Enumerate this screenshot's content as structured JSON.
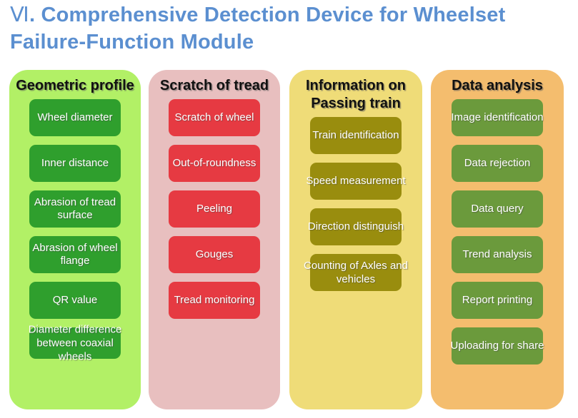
{
  "title": {
    "numeral": "Ⅵ",
    "text": ". Comprehensive Detection Device for Wheelset Failure-Function Module",
    "color": "#5b8fd0"
  },
  "columns": [
    {
      "id": "geometric-profile",
      "header": "Geometric profile",
      "panel_color": "#b2f066",
      "box_color": "#2f9f2d",
      "items": [
        "Wheel diameter",
        "Inner distance",
        "Abrasion of tread surface",
        "Abrasion of wheel flange",
        "QR value",
        "Diameter difference between coaxial wheels"
      ]
    },
    {
      "id": "scratch-of-tread",
      "header": "Scratch of tread",
      "panel_color": "#e8bfbf",
      "box_color": "#e63a42",
      "items": [
        "Scratch of wheel",
        "Out-of-roundness",
        "Peeling",
        "Gouges",
        "Tread monitoring"
      ]
    },
    {
      "id": "information-on-passing-train",
      "header": "Information on Passing train",
      "panel_color": "#efdc78",
      "box_color": "#998d0e",
      "items": [
        "Train identification",
        "Speed measurement",
        "Direction distinguish",
        "Counting of Axles and vehicles"
      ]
    },
    {
      "id": "data-analysis",
      "header": "Data analysis",
      "panel_color": "#f4bd6e",
      "box_color": "#6b9a3c",
      "items": [
        "Image identification",
        "Data rejection",
        "Data query",
        "Trend analysis",
        "Report printing",
        "Uploading for share"
      ]
    }
  ]
}
